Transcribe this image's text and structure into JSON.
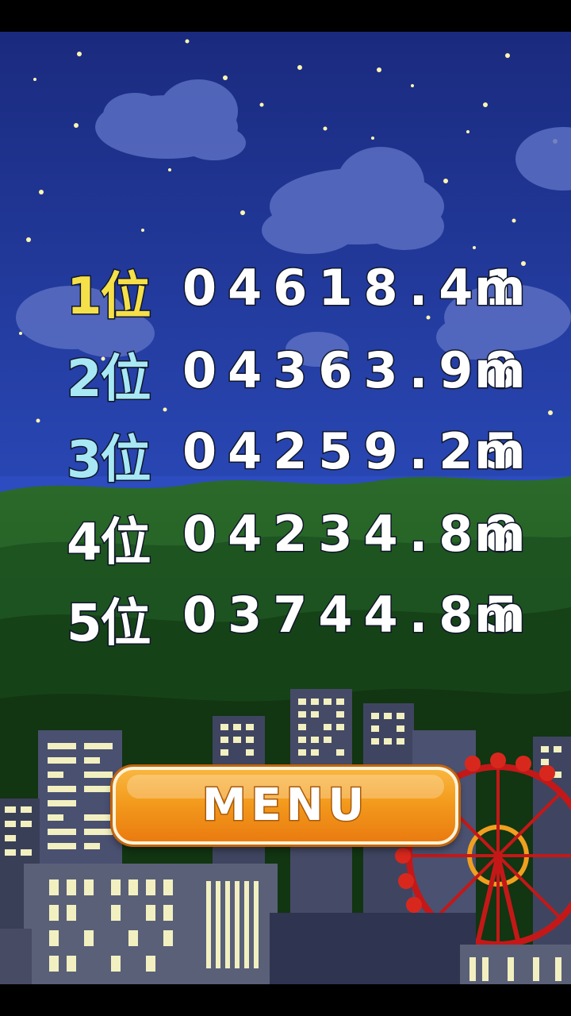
{
  "rankings": [
    {
      "label": "1位",
      "score": "04618.41",
      "unit": "m",
      "color": "#f5e04a"
    },
    {
      "label": "2位",
      "score": "04363.98",
      "unit": "m",
      "color": "#a7e8f4"
    },
    {
      "label": "3位",
      "score": "04259.25",
      "unit": "m",
      "color": "#a7e8f4"
    },
    {
      "label": "4位",
      "score": "04234.88",
      "unit": "m",
      "color": "#ffffff"
    },
    {
      "label": "5位",
      "score": "03744.85",
      "unit": "m",
      "color": "#ffffff"
    }
  ],
  "menu_button": {
    "label": "MENU"
  },
  "colors": {
    "sky_top": "#1c2f8a",
    "sky_bottom": "#2340b0",
    "hills": "#1f5a22",
    "button": "#f39b1d"
  }
}
